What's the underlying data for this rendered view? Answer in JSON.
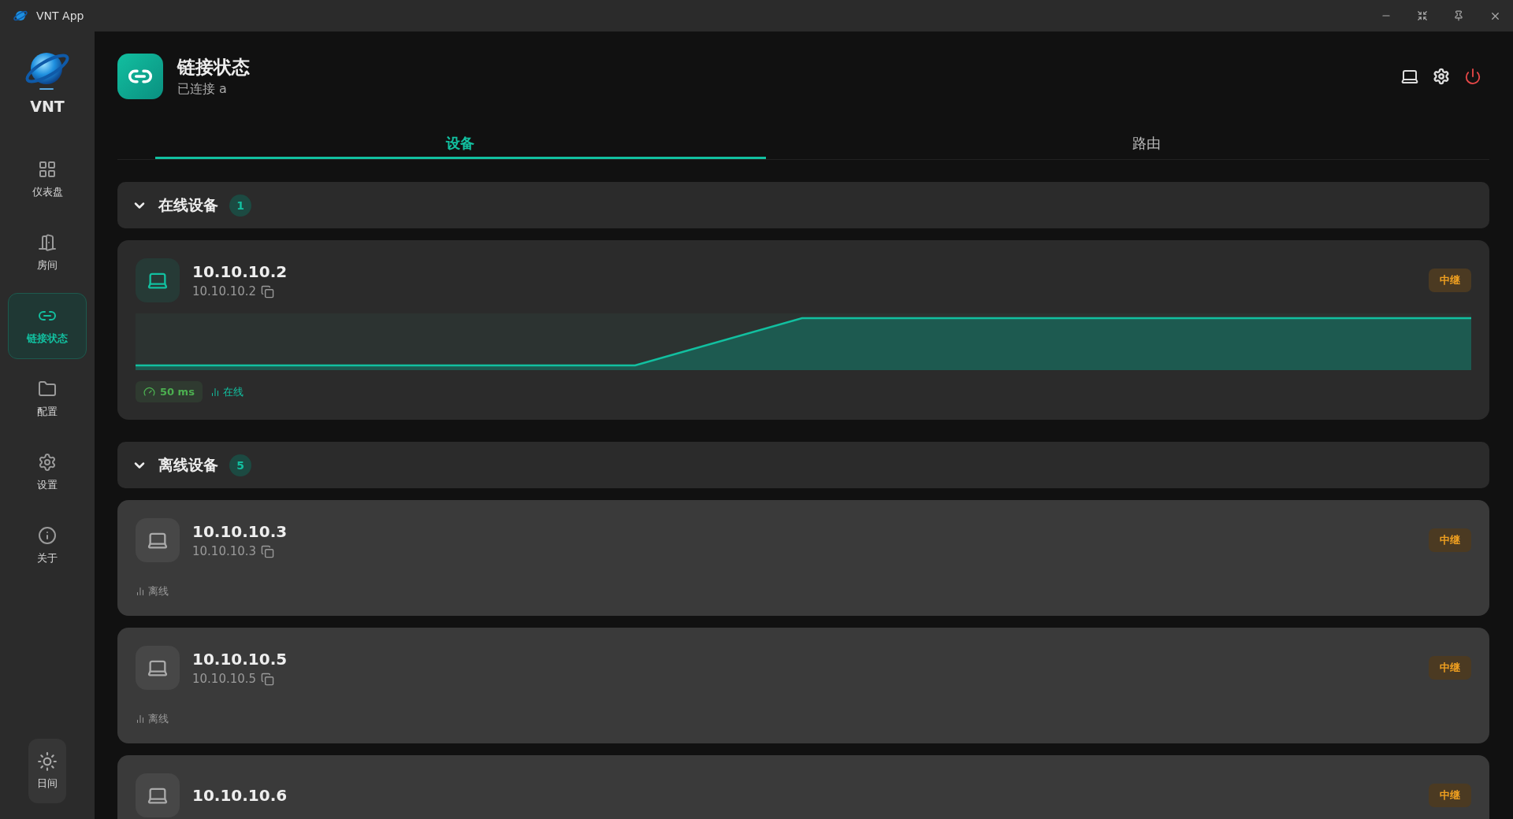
{
  "window": {
    "title": "VNT App"
  },
  "sidebar": {
    "brand": "VNT",
    "items": [
      {
        "label": "仪表盘",
        "selected": false
      },
      {
        "label": "房间",
        "selected": false
      },
      {
        "label": "链接状态",
        "selected": true
      },
      {
        "label": "配置",
        "selected": false
      },
      {
        "label": "设置",
        "selected": false
      },
      {
        "label": "关于",
        "selected": false
      }
    ],
    "theme_toggle": {
      "label": "日间"
    }
  },
  "header": {
    "title": "链接状态",
    "subtitle": "已连接 a"
  },
  "tabs": [
    {
      "label": "设备",
      "selected": true
    },
    {
      "label": "路由",
      "selected": false
    }
  ],
  "sections": [
    {
      "title": "在线设备",
      "count": "1",
      "expanded": true,
      "devices": [
        {
          "name": "10.10.10.2",
          "ip": "10.10.10.2",
          "relay": "中继",
          "online": true,
          "latency": "50 ms",
          "status": "在线"
        }
      ]
    },
    {
      "title": "离线设备",
      "count": "5",
      "expanded": true,
      "devices": [
        {
          "name": "10.10.10.3",
          "ip": "10.10.10.3",
          "relay": "中继",
          "online": false,
          "status": "离线"
        },
        {
          "name": "10.10.10.5",
          "ip": "10.10.10.5",
          "relay": "中继",
          "online": false,
          "status": "离线"
        },
        {
          "name": "10.10.10.6",
          "relay": "中继",
          "online": false
        }
      ]
    }
  ]
}
